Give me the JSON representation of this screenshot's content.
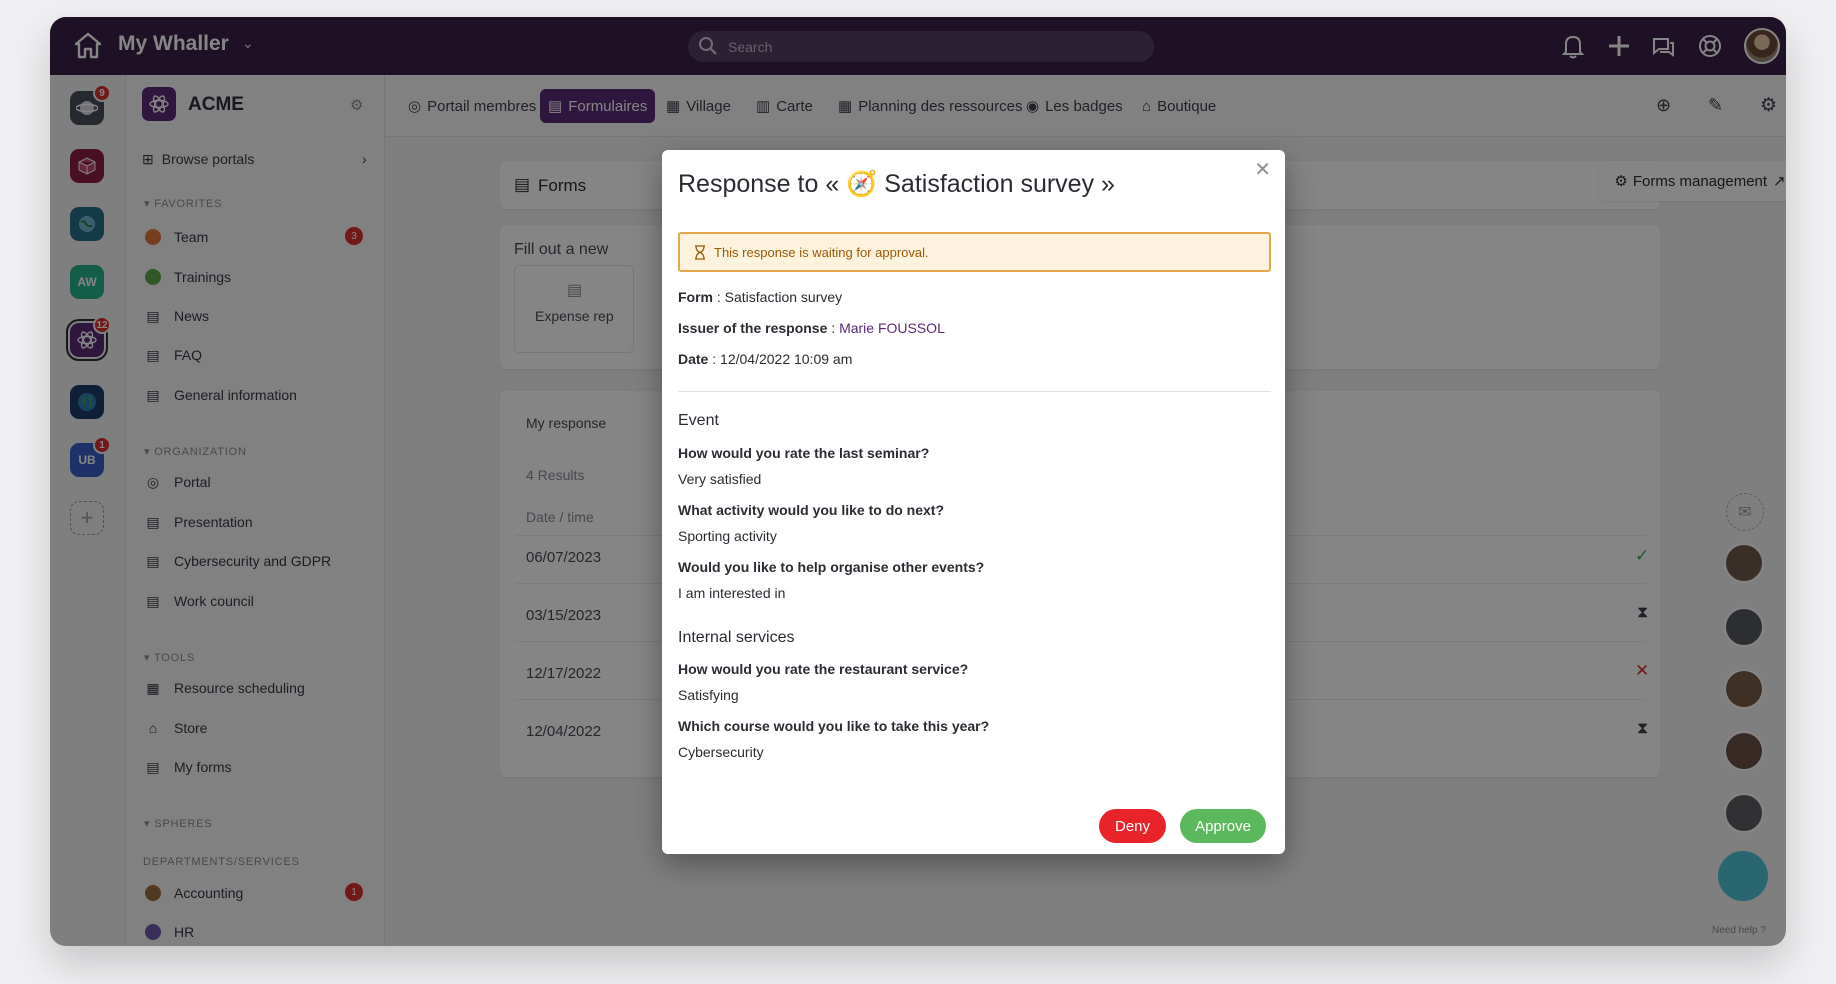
{
  "topbar": {
    "app_title": "My Whaller",
    "search_placeholder": "Search"
  },
  "rail": {
    "items": [
      {
        "icon": "planet-icon",
        "badge": "9"
      },
      {
        "icon": "cube-icon",
        "badge": ""
      },
      {
        "icon": "globe-icon",
        "badge": ""
      },
      {
        "label": "AW",
        "badge": ""
      },
      {
        "icon": "atom-icon",
        "badge": "12"
      },
      {
        "icon": "earth-icon",
        "badge": ""
      },
      {
        "label": "UB",
        "badge": "1"
      }
    ]
  },
  "sidebar": {
    "title": "ACME",
    "browse": "Browse portals",
    "favorites_label": "FAVORITES",
    "favorites": [
      {
        "label": "Team",
        "badge": "3"
      },
      {
        "label": "Trainings"
      },
      {
        "label": "News"
      },
      {
        "label": "FAQ"
      },
      {
        "label": "General information"
      }
    ],
    "organization_label": "ORGANIZATION",
    "organization": [
      {
        "label": "Portal"
      },
      {
        "label": "Presentation"
      },
      {
        "label": "Cybersecurity and GDPR"
      },
      {
        "label": "Work council"
      }
    ],
    "tools_label": "TOOLS",
    "tools": [
      {
        "label": "Resource scheduling"
      },
      {
        "label": "Store"
      },
      {
        "label": "My forms"
      }
    ],
    "spheres_label": "SPHERES",
    "departments_label": "DEPARTMENTS/SERVICES",
    "departments": [
      {
        "label": "Accounting",
        "badge": "1"
      },
      {
        "label": "HR"
      }
    ]
  },
  "tabs": [
    {
      "label": "Portail membres"
    },
    {
      "label": "Formulaires"
    },
    {
      "label": "Village"
    },
    {
      "label": "Carte"
    },
    {
      "label": "Planning des ressources"
    },
    {
      "label": "Les badges"
    },
    {
      "label": "Boutique"
    }
  ],
  "forms_page": {
    "title": "Forms",
    "management": "Forms management",
    "fill_out": "Fill out a new",
    "expense": "Expense rep",
    "my_responses": "My response",
    "results": "4 Results",
    "date_col": "Date / time",
    "rows": [
      {
        "date": "06/07/2023",
        "status": "check"
      },
      {
        "date": "03/15/2023",
        "status": "hourglass"
      },
      {
        "date": "12/17/2022",
        "status": "cross"
      },
      {
        "date": "12/04/2022",
        "status": "hourglass"
      }
    ]
  },
  "need_help": "Need help ?",
  "modal": {
    "title_prefix": "Response to « ",
    "title_emoji": "🧭",
    "title_name": " Satisfaction survey »",
    "alert": "This response is waiting for approval.",
    "form_label": "Form",
    "form_value": "Satisfaction survey",
    "issuer_label": "Issuer of the response",
    "issuer_value": "Marie FOUSSOL",
    "date_label": "Date",
    "date_value": "12/04/2022 10:09 am",
    "section1": "Event",
    "q1": "How would you rate the last seminar?",
    "a1": "Very satisfied",
    "q2": "What activity would you like to do next?",
    "a2": "Sporting activity",
    "q3": "Would you like to help organise other events?",
    "a3": "I am interested in",
    "section2": "Internal services",
    "q4": "How would you rate the restaurant service?",
    "a4": "Satisfying",
    "q5": "Which course would you like to take this year?",
    "a5": "Cybersecurity",
    "deny": "Deny",
    "approve": "Approve"
  },
  "colors": {
    "topbar": "#3b2147",
    "accent": "#5b2b78",
    "deny": "#e9232a",
    "approve": "#5cb85c",
    "alert_border": "#e4a84b"
  }
}
